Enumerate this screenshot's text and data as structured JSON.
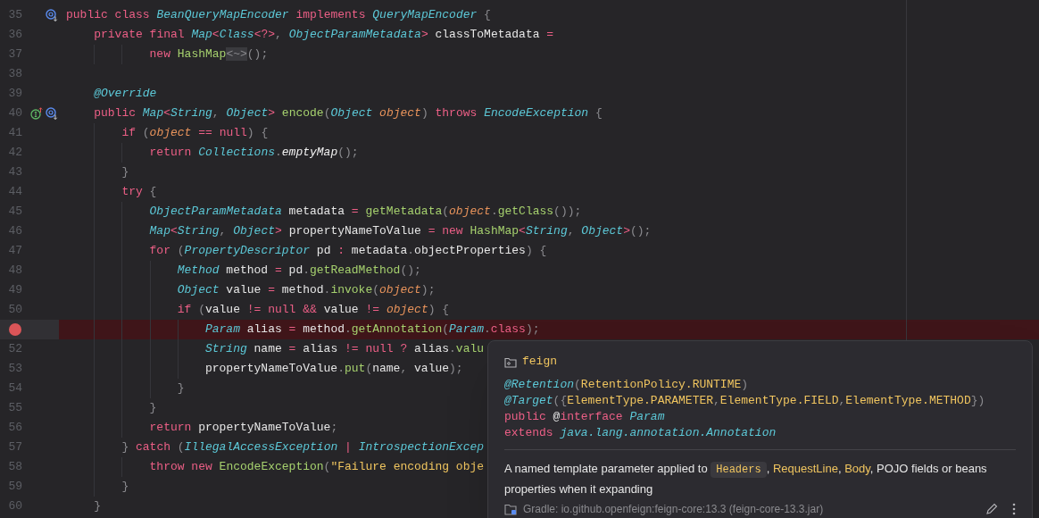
{
  "editor": {
    "lines": [
      {
        "number": "35",
        "breakpoint": false,
        "gutter_icons": [
          {
            "kind": "overridden"
          }
        ],
        "tokens": [
          {
            "kind": "kw",
            "text": "public class "
          },
          {
            "kind": "type",
            "text": "BeanQueryMapEncoder"
          },
          {
            "kind": "kw",
            "text": " implements "
          },
          {
            "kind": "type",
            "text": "QueryMapEncoder"
          },
          {
            "kind": "punct",
            "text": " {"
          }
        ],
        "children": [
          {
            "number": "36",
            "breakpoint": false,
            "tokens": [
              {
                "kind": "kw",
                "text": "private final "
              },
              {
                "kind": "type",
                "text": "Map"
              },
              {
                "kind": "op",
                "text": "<"
              },
              {
                "kind": "type",
                "text": "Class"
              },
              {
                "kind": "op",
                "text": "<?>"
              },
              {
                "kind": "punct",
                "text": ", "
              },
              {
                "kind": "type",
                "text": "ObjectParamMetadata"
              },
              {
                "kind": "op",
                "text": ">"
              },
              {
                "kind": "id",
                "text": " classToMetadata"
              },
              {
                "kind": "op",
                "text": " ="
              }
            ],
            "children": [
              {
                "number": "37",
                "kind": "continuation",
                "breakpoint": false,
                "tokens": [
                  {
                    "kind": "kw",
                    "text": "new "
                  },
                  {
                    "kind": "method",
                    "text": "HashMap"
                  },
                  {
                    "kind": "folded",
                    "text": "<~>"
                  },
                  {
                    "kind": "punct",
                    "text": "();"
                  }
                ]
              }
            ]
          },
          {
            "number": "38",
            "breakpoint": false
          },
          {
            "number": "39",
            "breakpoint": false,
            "tokens": [
              {
                "kind": "anno",
                "text": "@Override"
              }
            ]
          },
          {
            "number": "40",
            "breakpoint": false,
            "gutter_icons": [
              {
                "kind": "implements"
              },
              {
                "kind": "overridden"
              }
            ],
            "tokens": [
              {
                "kind": "kw",
                "text": "public "
              },
              {
                "kind": "type",
                "text": "Map"
              },
              {
                "kind": "op",
                "text": "<"
              },
              {
                "kind": "type",
                "text": "String"
              },
              {
                "kind": "punct",
                "text": ", "
              },
              {
                "kind": "type",
                "text": "Object"
              },
              {
                "kind": "op",
                "text": ">"
              },
              {
                "kind": "method",
                "text": " encode"
              },
              {
                "kind": "punct",
                "text": "("
              },
              {
                "kind": "type",
                "text": "Object"
              },
              {
                "kind": "param",
                "text": " object"
              },
              {
                "kind": "punct",
                "text": ") "
              },
              {
                "kind": "kw",
                "text": "throws "
              },
              {
                "kind": "type",
                "text": "EncodeException"
              },
              {
                "kind": "punct",
                "text": " {"
              }
            ],
            "children": [
              {
                "number": "41",
                "breakpoint": false,
                "tokens": [
                  {
                    "kind": "kw",
                    "text": "if "
                  },
                  {
                    "kind": "punct",
                    "text": "("
                  },
                  {
                    "kind": "param",
                    "text": "object"
                  },
                  {
                    "kind": "op",
                    "text": " == "
                  },
                  {
                    "kind": "kw",
                    "text": "null"
                  },
                  {
                    "kind": "punct",
                    "text": ") {"
                  }
                ],
                "children": [
                  {
                    "number": "42",
                    "breakpoint": false,
                    "tokens": [
                      {
                        "kind": "kw",
                        "text": "return "
                      },
                      {
                        "kind": "type",
                        "text": "Collections"
                      },
                      {
                        "kind": "punct",
                        "text": "."
                      },
                      {
                        "kind": "static",
                        "text": "emptyMap"
                      },
                      {
                        "kind": "punct",
                        "text": "();"
                      }
                    ]
                  }
                ]
              },
              {
                "number": "43",
                "breakpoint": false,
                "tokens": [
                  {
                    "kind": "punct",
                    "text": "}"
                  }
                ]
              },
              {
                "number": "44",
                "breakpoint": false,
                "tokens": [
                  {
                    "kind": "kw",
                    "text": "try "
                  },
                  {
                    "kind": "punct",
                    "text": "{"
                  }
                ],
                "children": [
                  {
                    "number": "45",
                    "breakpoint": false,
                    "tokens": [
                      {
                        "kind": "type",
                        "text": "ObjectParamMetadata"
                      },
                      {
                        "kind": "id",
                        "text": " metadata"
                      },
                      {
                        "kind": "op",
                        "text": " = "
                      },
                      {
                        "kind": "method",
                        "text": "getMetadata"
                      },
                      {
                        "kind": "punct",
                        "text": "("
                      },
                      {
                        "kind": "param",
                        "text": "object"
                      },
                      {
                        "kind": "punct",
                        "text": "."
                      },
                      {
                        "kind": "method",
                        "text": "getClass"
                      },
                      {
                        "kind": "punct",
                        "text": "());"
                      }
                    ]
                  },
                  {
                    "number": "46",
                    "breakpoint": false,
                    "tokens": [
                      {
                        "kind": "type",
                        "text": "Map"
                      },
                      {
                        "kind": "op",
                        "text": "<"
                      },
                      {
                        "kind": "type",
                        "text": "String"
                      },
                      {
                        "kind": "punct",
                        "text": ", "
                      },
                      {
                        "kind": "type",
                        "text": "Object"
                      },
                      {
                        "kind": "op",
                        "text": ">"
                      },
                      {
                        "kind": "id",
                        "text": " propertyNameToValue"
                      },
                      {
                        "kind": "op",
                        "text": " = "
                      },
                      {
                        "kind": "kw",
                        "text": "new "
                      },
                      {
                        "kind": "method",
                        "text": "HashMap"
                      },
                      {
                        "kind": "op",
                        "text": "<"
                      },
                      {
                        "kind": "type",
                        "text": "String"
                      },
                      {
                        "kind": "punct",
                        "text": ", "
                      },
                      {
                        "kind": "type",
                        "text": "Object"
                      },
                      {
                        "kind": "op",
                        "text": ">"
                      },
                      {
                        "kind": "punct",
                        "text": "();"
                      }
                    ]
                  },
                  {
                    "number": "47",
                    "breakpoint": false,
                    "tokens": [
                      {
                        "kind": "kw",
                        "text": "for "
                      },
                      {
                        "kind": "punct",
                        "text": "("
                      },
                      {
                        "kind": "type",
                        "text": "PropertyDescriptor"
                      },
                      {
                        "kind": "id",
                        "text": " pd"
                      },
                      {
                        "kind": "op",
                        "text": " : "
                      },
                      {
                        "kind": "id",
                        "text": "metadata"
                      },
                      {
                        "kind": "punct",
                        "text": "."
                      },
                      {
                        "kind": "id",
                        "text": "objectProperties"
                      },
                      {
                        "kind": "punct",
                        "text": ") {"
                      }
                    ],
                    "children": [
                      {
                        "number": "48",
                        "breakpoint": false,
                        "tokens": [
                          {
                            "kind": "type",
                            "text": "Method"
                          },
                          {
                            "kind": "id",
                            "text": " method"
                          },
                          {
                            "kind": "op",
                            "text": " = "
                          },
                          {
                            "kind": "id",
                            "text": "pd"
                          },
                          {
                            "kind": "punct",
                            "text": "."
                          },
                          {
                            "kind": "method",
                            "text": "getReadMethod"
                          },
                          {
                            "kind": "punct",
                            "text": "();"
                          }
                        ]
                      },
                      {
                        "number": "49",
                        "breakpoint": false,
                        "tokens": [
                          {
                            "kind": "type",
                            "text": "Object"
                          },
                          {
                            "kind": "id",
                            "text": " value"
                          },
                          {
                            "kind": "op",
                            "text": " = "
                          },
                          {
                            "kind": "id",
                            "text": "method"
                          },
                          {
                            "kind": "punct",
                            "text": "."
                          },
                          {
                            "kind": "method",
                            "text": "invoke"
                          },
                          {
                            "kind": "punct",
                            "text": "("
                          },
                          {
                            "kind": "param",
                            "text": "object"
                          },
                          {
                            "kind": "punct",
                            "text": ");"
                          }
                        ]
                      },
                      {
                        "number": "50",
                        "breakpoint": false,
                        "tokens": [
                          {
                            "kind": "kw",
                            "text": "if "
                          },
                          {
                            "kind": "punct",
                            "text": "("
                          },
                          {
                            "kind": "id",
                            "text": "value"
                          },
                          {
                            "kind": "op",
                            "text": " != "
                          },
                          {
                            "kind": "kw",
                            "text": "null"
                          },
                          {
                            "kind": "op",
                            "text": " && "
                          },
                          {
                            "kind": "id",
                            "text": "value"
                          },
                          {
                            "kind": "op",
                            "text": " != "
                          },
                          {
                            "kind": "param",
                            "text": "object"
                          },
                          {
                            "kind": "punct",
                            "text": ") {"
                          }
                        ],
                        "children": [
                          {
                            "breakpoint": true,
                            "tokens": [
                              {
                                "kind": "type",
                                "text": "Param"
                              },
                              {
                                "kind": "id",
                                "text": " alias"
                              },
                              {
                                "kind": "op",
                                "text": " = "
                              },
                              {
                                "kind": "id",
                                "text": "method"
                              },
                              {
                                "kind": "punct",
                                "text": "."
                              },
                              {
                                "kind": "method",
                                "text": "getAnnotation"
                              },
                              {
                                "kind": "punct",
                                "text": "("
                              },
                              {
                                "kind": "type",
                                "text": "Param"
                              },
                              {
                                "kind": "punct",
                                "text": "."
                              },
                              {
                                "kind": "kw",
                                "text": "class"
                              },
                              {
                                "kind": "punct",
                                "text": ");"
                              }
                            ]
                          },
                          {
                            "number": "52",
                            "breakpoint": false,
                            "tokens": [
                              {
                                "kind": "type",
                                "text": "String"
                              },
                              {
                                "kind": "id",
                                "text": " name"
                              },
                              {
                                "kind": "op",
                                "text": " = "
                              },
                              {
                                "kind": "id",
                                "text": "alias"
                              },
                              {
                                "kind": "op",
                                "text": " != "
                              },
                              {
                                "kind": "kw",
                                "text": "null"
                              },
                              {
                                "kind": "op",
                                "text": " ? "
                              },
                              {
                                "kind": "id",
                                "text": "alias"
                              },
                              {
                                "kind": "punct",
                                "text": "."
                              },
                              {
                                "kind": "method",
                                "text": "valu"
                              }
                            ]
                          },
                          {
                            "number": "53",
                            "breakpoint": false,
                            "tokens": [
                              {
                                "kind": "id",
                                "text": "propertyNameToValue"
                              },
                              {
                                "kind": "punct",
                                "text": "."
                              },
                              {
                                "kind": "method",
                                "text": "put"
                              },
                              {
                                "kind": "punct",
                                "text": "("
                              },
                              {
                                "kind": "id",
                                "text": "name"
                              },
                              {
                                "kind": "punct",
                                "text": ", "
                              },
                              {
                                "kind": "id",
                                "text": "value"
                              },
                              {
                                "kind": "punct",
                                "text": ");"
                              }
                            ]
                          }
                        ]
                      },
                      {
                        "number": "54",
                        "breakpoint": false,
                        "tokens": [
                          {
                            "kind": "punct",
                            "text": "}"
                          }
                        ]
                      }
                    ]
                  },
                  {
                    "number": "55",
                    "breakpoint": false,
                    "tokens": [
                      {
                        "kind": "punct",
                        "text": "}"
                      }
                    ]
                  },
                  {
                    "number": "56",
                    "breakpoint": false,
                    "tokens": [
                      {
                        "kind": "kw",
                        "text": "return "
                      },
                      {
                        "kind": "id",
                        "text": "propertyNameToValue"
                      },
                      {
                        "kind": "punct",
                        "text": ";"
                      }
                    ]
                  }
                ]
              },
              {
                "number": "57",
                "breakpoint": false,
                "tokens": [
                  {
                    "kind": "punct",
                    "text": "} "
                  },
                  {
                    "kind": "kw",
                    "text": "catch "
                  },
                  {
                    "kind": "punct",
                    "text": "("
                  },
                  {
                    "kind": "type",
                    "text": "IllegalAccessException"
                  },
                  {
                    "kind": "op",
                    "text": " | "
                  },
                  {
                    "kind": "type",
                    "text": "IntrospectionExcep"
                  }
                ],
                "children": [
                  {
                    "number": "58",
                    "breakpoint": false,
                    "tokens": [
                      {
                        "kind": "kw",
                        "text": "throw new "
                      },
                      {
                        "kind": "method",
                        "text": "EncodeException"
                      },
                      {
                        "kind": "punct",
                        "text": "("
                      },
                      {
                        "kind": "str",
                        "text": "\"Failure encoding obje"
                      }
                    ]
                  }
                ]
              },
              {
                "number": "59",
                "breakpoint": false,
                "tokens": [
                  {
                    "kind": "punct",
                    "text": "}"
                  }
                ]
              }
            ]
          },
          {
            "number": "60",
            "breakpoint": false,
            "tokens": [
              {
                "kind": "punct",
                "text": "}"
              }
            ]
          }
        ]
      }
    ]
  },
  "popup": {
    "package": "feign",
    "signature": [
      [
        {
          "kind": "anno",
          "text": "@Retention"
        },
        {
          "kind": "punct",
          "text": "("
        },
        {
          "kind": "const",
          "text": "RetentionPolicy.RUNTIME"
        },
        {
          "kind": "punct",
          "text": ")"
        }
      ],
      [
        {
          "kind": "anno",
          "text": "@Target"
        },
        {
          "kind": "punct",
          "text": "({"
        },
        {
          "kind": "const",
          "text": "ElementType.PARAMETER"
        },
        {
          "kind": "punct",
          "text": ","
        },
        {
          "kind": "const",
          "text": "ElementType.FIELD"
        },
        {
          "kind": "punct",
          "text": ","
        },
        {
          "kind": "const",
          "text": "ElementType.METHOD"
        },
        {
          "kind": "punct",
          "text": "})"
        }
      ],
      [
        {
          "kind": "kw",
          "text": "public "
        },
        {
          "kind": "id",
          "text": "@"
        },
        {
          "kind": "kw",
          "text": "interface "
        },
        {
          "kind": "type",
          "text": "Param"
        }
      ],
      [
        {
          "kind": "kw",
          "text": "extends "
        },
        {
          "kind": "type",
          "text": "java.lang.annotation.Annotation"
        }
      ]
    ],
    "description": [
      {
        "kind": "text",
        "text": "A named template parameter applied to "
      },
      {
        "kind": "code",
        "text": "Headers"
      },
      {
        "kind": "text",
        "text": ", "
      },
      {
        "kind": "link",
        "text": "RequestLine"
      },
      {
        "kind": "text",
        "text": ", "
      },
      {
        "kind": "link",
        "text": "Body"
      },
      {
        "kind": "text",
        "text": ", POJO fields or beans properties when it expanding"
      }
    ],
    "source": "Gradle: io.github.openfeign:feign-core:13.3 (feign-core-13.3.jar)"
  }
}
